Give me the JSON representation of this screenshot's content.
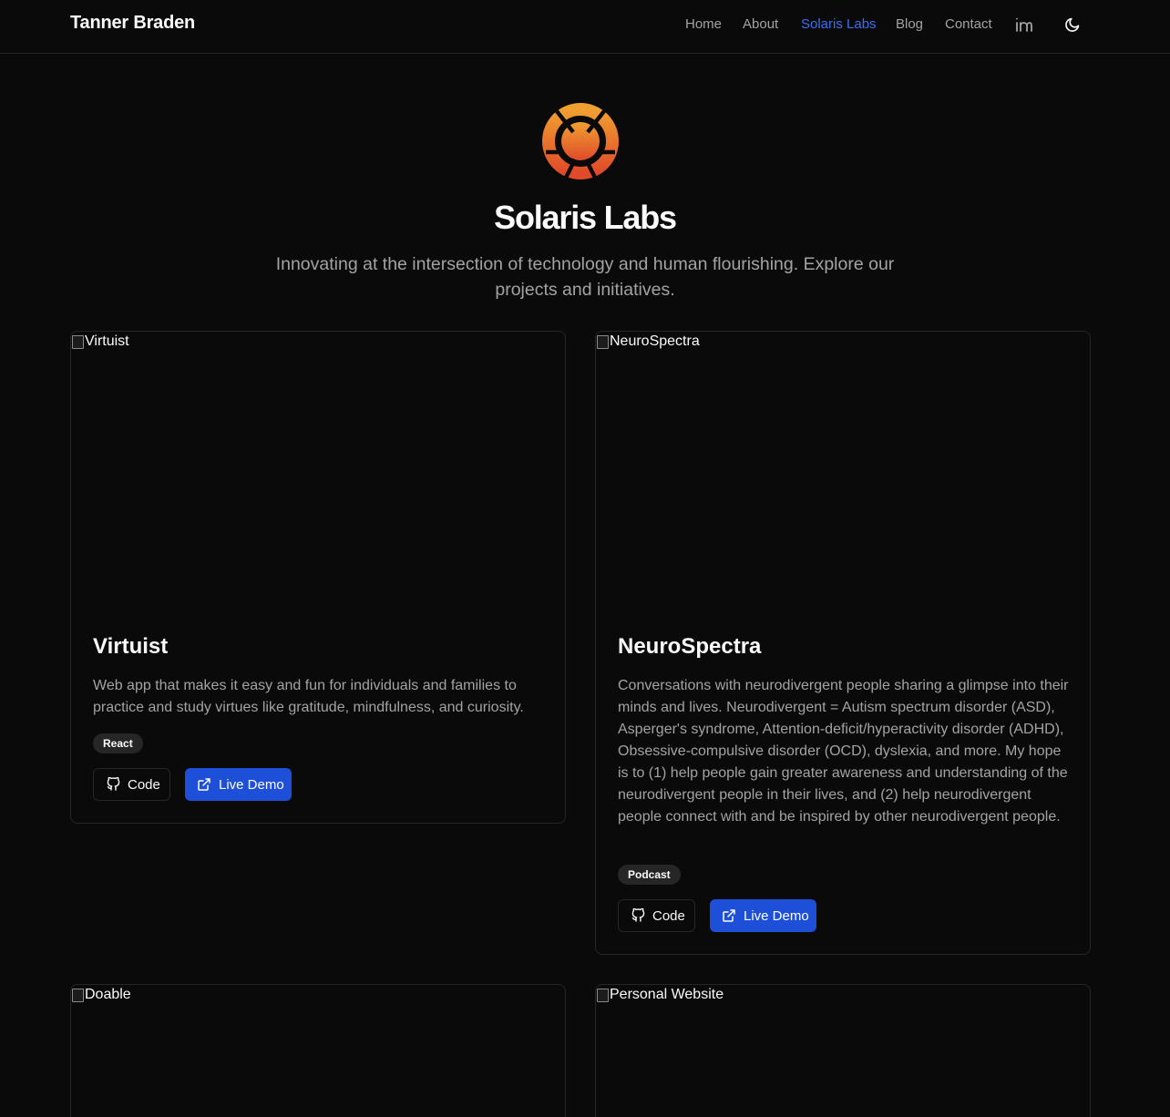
{
  "nav": {
    "brand": "Tanner Braden",
    "links": [
      "Home",
      "About",
      "Solaris Labs",
      "Blog",
      "Contact"
    ],
    "active": "Solaris Labs",
    "icons": [
      "linkedin-icon",
      "moon-icon"
    ]
  },
  "hero": {
    "title": "Solaris Labs",
    "subtitle": "Innovating at the intersection of technology and human flourishing. Explore our projects and initiatives."
  },
  "colors": {
    "accent": "#3b6ef5",
    "button_primary": "#1d4fd8",
    "logo_gradient": [
      "#f0a030",
      "#e04a2a"
    ]
  },
  "projects": [
    {
      "image_alt": "Virtuist",
      "title": "Virtuist",
      "description": "Web app that makes it easy and fun for individuals and families to practice and study virtues like gratitude, mindfulness, and curiosity.",
      "tag": "React",
      "code_label": "Code",
      "demo_label": "Live Demo"
    },
    {
      "image_alt": "NeuroSpectra",
      "title": "NeuroSpectra",
      "description": "Conversations with neurodivergent people sharing a glimpse into their minds and lives. Neurodivergent = Autism spectrum disorder (ASD), Asperger's syndrome, Attention-deficit/hyperactivity disorder (ADHD), Obsessive-compulsive disorder (OCD), dyslexia, and more. My hope is to (1) help people gain greater awareness and understanding of the neurodivergent people in their lives, and (2) help neurodivergent people connect with and be inspired by other neurodivergent people.",
      "tag": "Podcast",
      "code_label": "Code",
      "demo_label": "Live Demo"
    },
    {
      "image_alt": "Doable"
    },
    {
      "image_alt": "Personal Website"
    }
  ]
}
